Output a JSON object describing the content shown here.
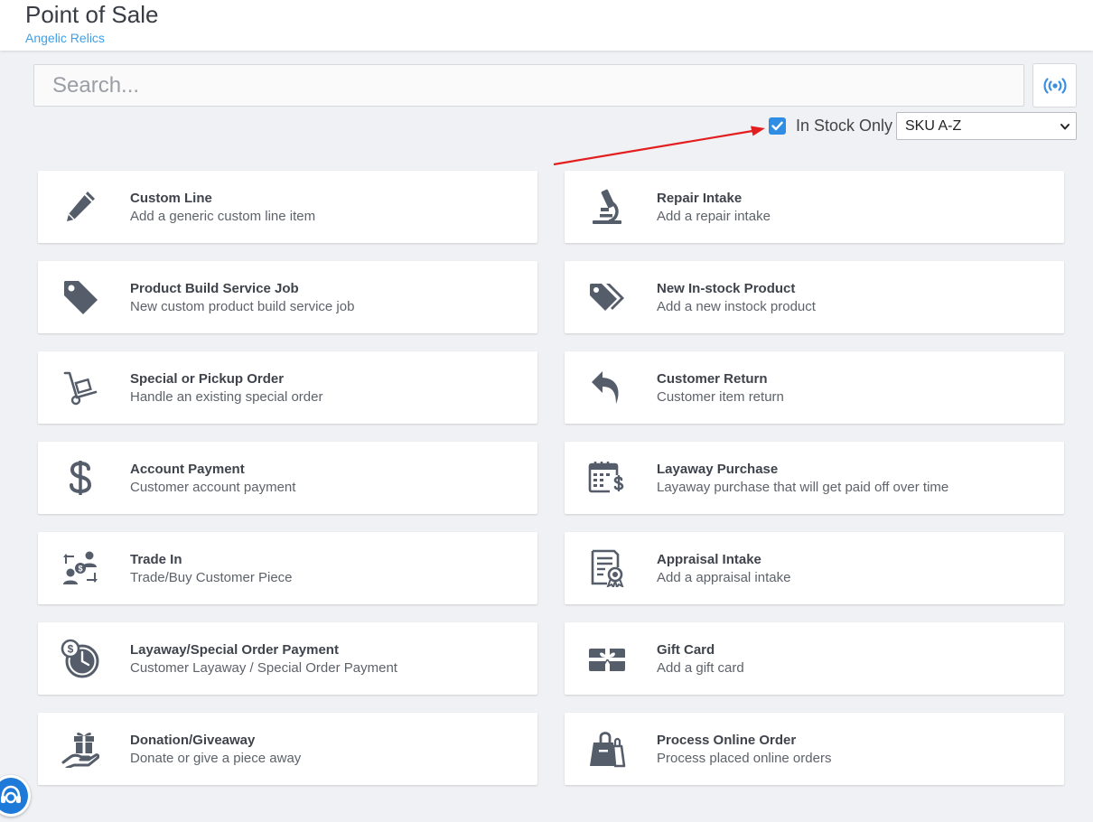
{
  "header": {
    "title": "Point of Sale",
    "subtitle": "Angelic Relics"
  },
  "search": {
    "placeholder": "Search..."
  },
  "filters": {
    "in_stock_label": "In Stock Only",
    "in_stock_checked": true,
    "sort_selected": "SKU A-Z"
  },
  "colors": {
    "accent": "#2f8de4",
    "subtitle": "#3ea0e8",
    "icon": "#555d6b",
    "annotation_arrow": "#e31e1e"
  },
  "cards": [
    {
      "title": "Custom Line",
      "subtitle": "Add a generic custom line item",
      "icon": "pencil-icon"
    },
    {
      "title": "Repair Intake",
      "subtitle": "Add a repair intake",
      "icon": "microscope-icon"
    },
    {
      "title": "Product Build Service Job",
      "subtitle": "New custom product build service job",
      "icon": "tag-icon"
    },
    {
      "title": "New In-stock Product",
      "subtitle": "Add a new instock product",
      "icon": "tags-icon"
    },
    {
      "title": "Special or Pickup Order",
      "subtitle": "Handle an existing special order",
      "icon": "dolly-icon"
    },
    {
      "title": "Customer Return",
      "subtitle": "Customer item return",
      "icon": "reply-icon"
    },
    {
      "title": "Account Payment",
      "subtitle": "Customer account payment",
      "icon": "dollar-icon"
    },
    {
      "title": "Layaway Purchase",
      "subtitle": "Layaway purchase that will get paid off over time",
      "icon": "calendar-dollar-icon"
    },
    {
      "title": "Trade In",
      "subtitle": "Trade/Buy Customer Piece",
      "icon": "trade-exchange-icon"
    },
    {
      "title": "Appraisal Intake",
      "subtitle": "Add a appraisal intake",
      "icon": "certificate-icon"
    },
    {
      "title": "Layaway/Special Order Payment",
      "subtitle": "Customer Layaway / Special Order Payment",
      "icon": "time-money-icon"
    },
    {
      "title": "Gift Card",
      "subtitle": "Add a gift card",
      "icon": "gift-card-icon"
    },
    {
      "title": "Donation/Giveaway",
      "subtitle": "Donate or give a piece away",
      "icon": "gift-hand-icon"
    },
    {
      "title": "Process Online Order",
      "subtitle": "Process placed online orders",
      "icon": "shopping-bag-icon"
    }
  ]
}
